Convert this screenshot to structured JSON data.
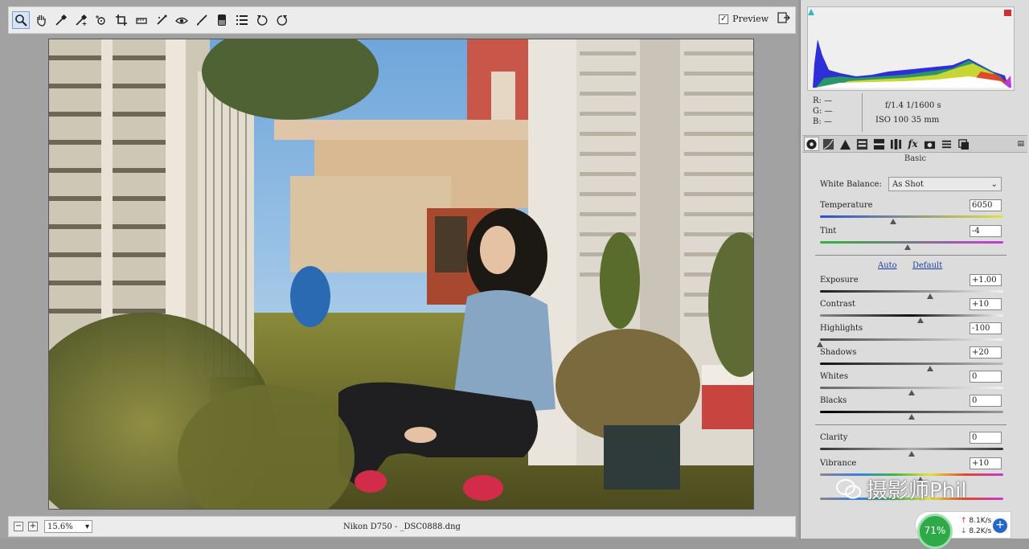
{
  "toolbar": {
    "tools": [
      "zoom-tool-icon",
      "hand-tool-icon",
      "white-balance-tool-icon",
      "color-sampler-icon",
      "targeted-adjustment-icon",
      "crop-tool-icon",
      "straighten-tool-icon",
      "spot-removal-icon",
      "red-eye-icon",
      "adjustment-brush-icon",
      "graduated-filter-icon",
      "preferences-icon",
      "rotate-left-icon",
      "rotate-right-icon"
    ],
    "preview_label": "Preview",
    "preview_checked": "✓"
  },
  "statusbar": {
    "zoom_value": "15.6%",
    "minus": "−",
    "plus": "+",
    "filename": "Nikon D750  -  _DSC0888.dng"
  },
  "camera": {
    "r_label": "R:",
    "r_value": "—",
    "g_label": "G:",
    "g_value": "—",
    "b_label": "B:",
    "b_value": "—",
    "aperture_shutter": "f/1.4   1/1600 s",
    "iso_focal": "ISO 100   35 mm"
  },
  "panel": {
    "title": "Basic",
    "white_balance_label": "White Balance:",
    "white_balance_value": "As Shot",
    "auto_label": "Auto",
    "default_label": "Default"
  },
  "sliders": [
    {
      "label": "Temperature",
      "value": "6050",
      "position": 0.4
    },
    {
      "label": "Tint",
      "value": "-4",
      "position": 0.48
    },
    {
      "label": "Exposure",
      "value": "+1.00",
      "position": 0.6
    },
    {
      "label": "Contrast",
      "value": "+10",
      "position": 0.55
    },
    {
      "label": "Highlights",
      "value": "-100",
      "position": 0.0
    },
    {
      "label": "Shadows",
      "value": "+20",
      "position": 0.6
    },
    {
      "label": "Whites",
      "value": "0",
      "position": 0.5
    },
    {
      "label": "Blacks",
      "value": "0",
      "position": 0.5
    },
    {
      "label": "Clarity",
      "value": "0",
      "position": 0.5
    },
    {
      "label": "Vibrance",
      "value": "+10",
      "position": 0.55
    }
  ],
  "watermark": {
    "text": "摄影师Phil"
  },
  "network": {
    "percent": "71%",
    "up": "8.1K/s",
    "down": "8.2K/s",
    "plus": "+"
  }
}
